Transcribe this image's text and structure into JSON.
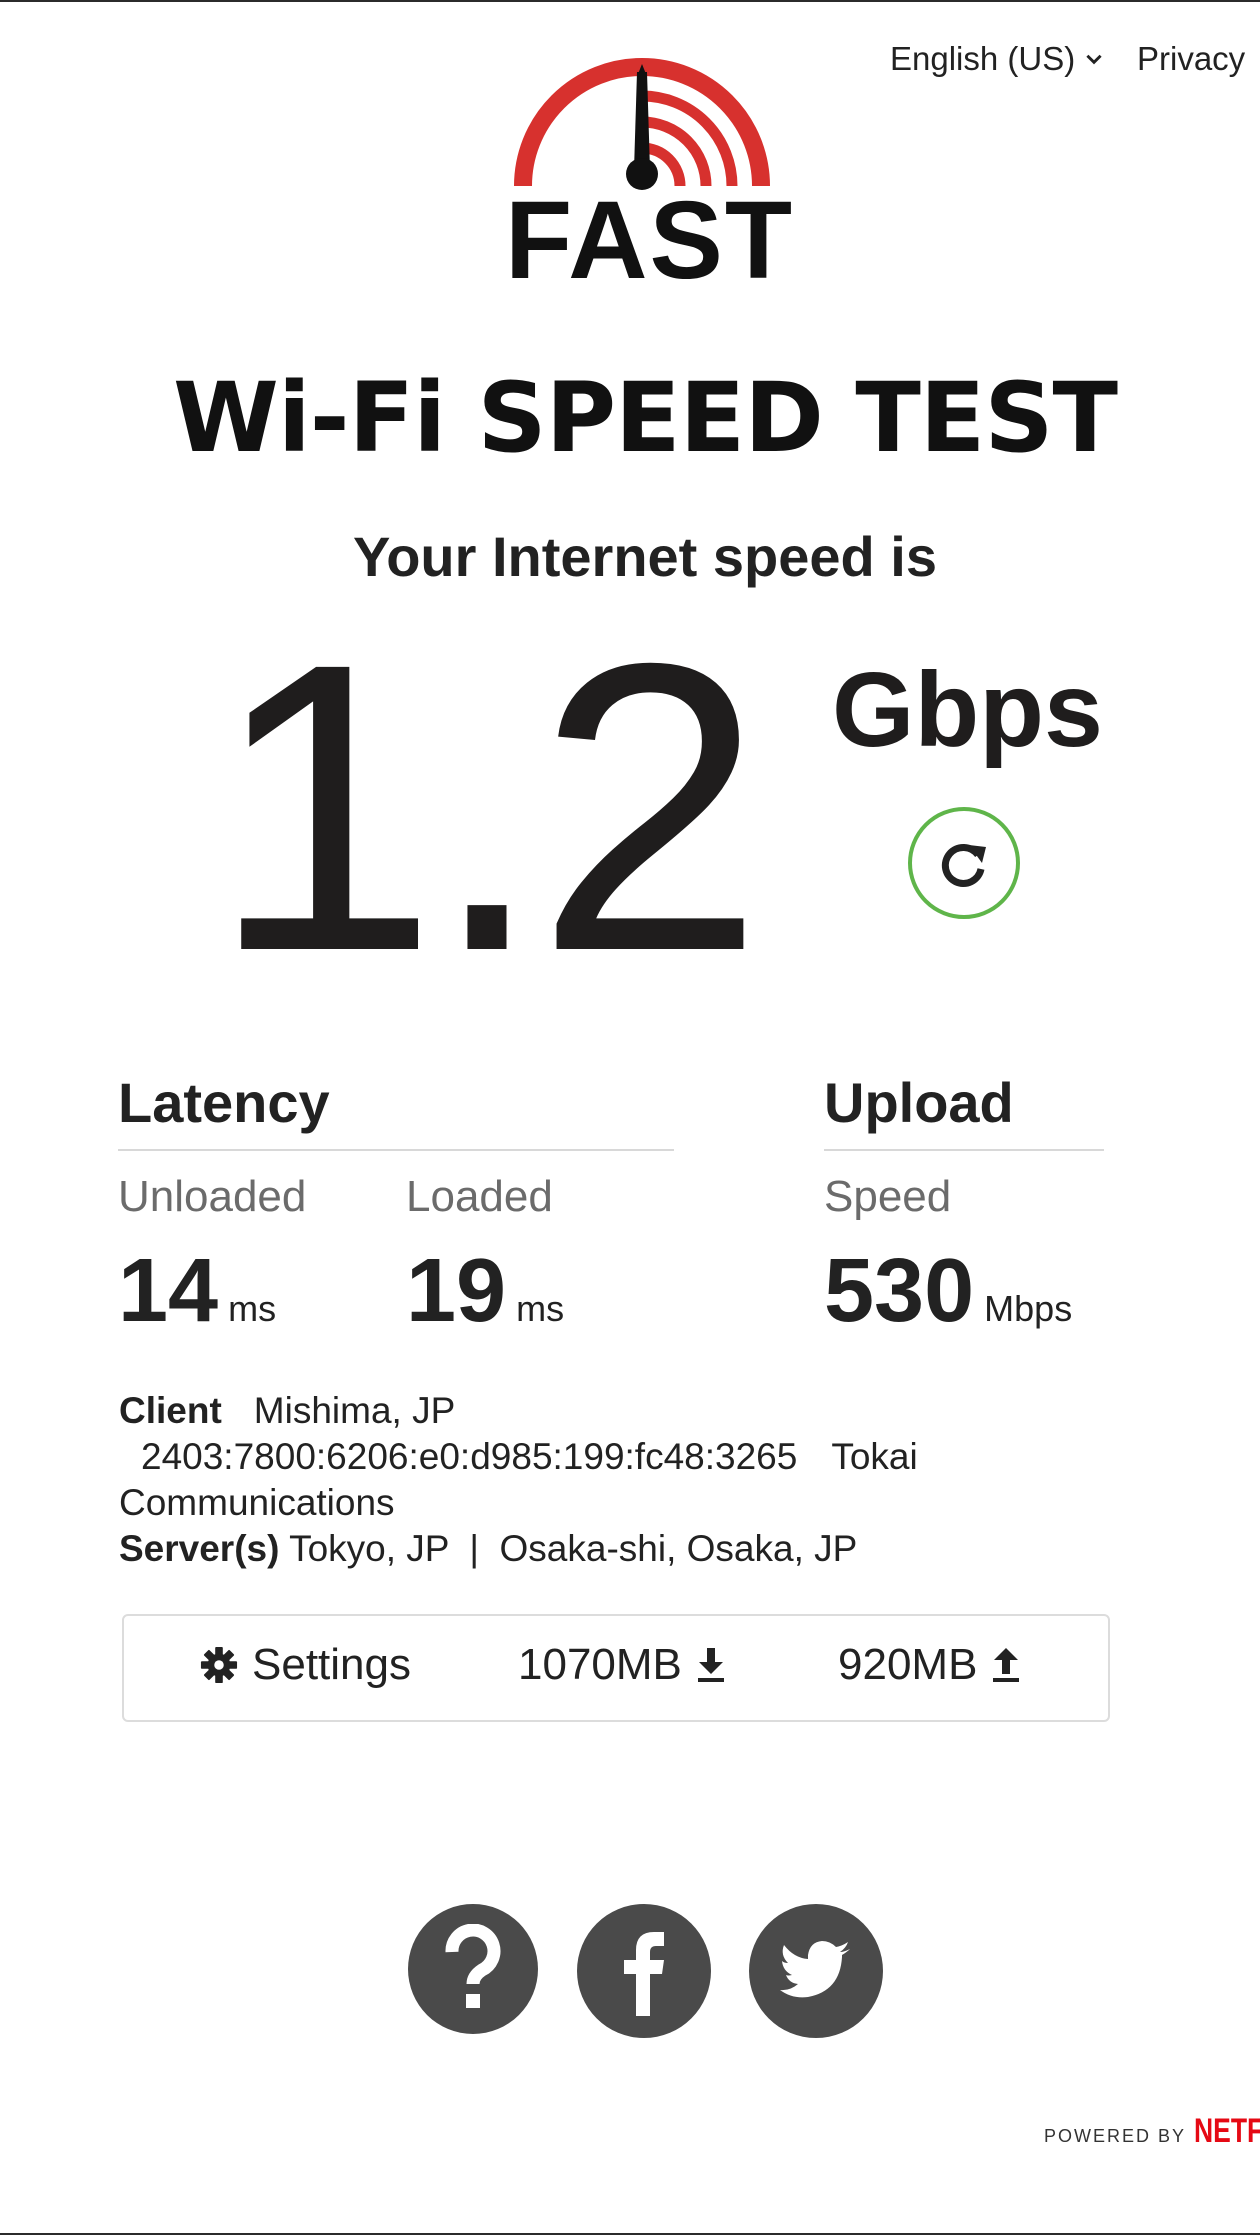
{
  "header": {
    "language": "English (US)",
    "language_icon": "chevron-down-icon",
    "privacy": "Privacy"
  },
  "logo": {
    "text": "FAST",
    "colors": {
      "gauge": "#d7312e",
      "needle": "#111111"
    }
  },
  "headline": "Wi-Fi SPEED TEST",
  "subheadline": "Your Internet speed is",
  "speed": {
    "value": "1.2",
    "unit": "Gbps",
    "refresh_icon": "refresh-icon",
    "refresh_color": "#5fb54a"
  },
  "latency": {
    "title": "Latency",
    "unloaded": {
      "label": "Unloaded",
      "value": "14",
      "unit": "ms"
    },
    "loaded": {
      "label": "Loaded",
      "value": "19",
      "unit": "ms"
    }
  },
  "upload": {
    "title": "Upload",
    "label": "Speed",
    "value": "530",
    "unit": "Mbps"
  },
  "info": {
    "client_label": "Client",
    "client_location": "Mishima, JP",
    "client_ip": "2403:7800:6206:e0:d985:199:fc48:3265",
    "client_isp_part1": "Tokai",
    "client_isp_part2": "Communications",
    "server_label": "Server(s)",
    "servers": "Tokyo, JP  |  Osaka-shi, Osaka, JP"
  },
  "settings_bar": {
    "settings_label": "Settings",
    "settings_icon": "gear-icon",
    "download_amount": "1070MB",
    "download_icon": "download-icon",
    "upload_amount": "920MB",
    "upload_icon": "upload-icon"
  },
  "social": [
    {
      "name": "help",
      "icon": "question-mark-icon"
    },
    {
      "name": "facebook",
      "icon": "facebook-icon"
    },
    {
      "name": "twitter",
      "icon": "twitter-icon"
    }
  ],
  "footer": {
    "powered_by": "POWERED BY",
    "brand": "NETFLIX",
    "brand_color": "#e50914"
  }
}
